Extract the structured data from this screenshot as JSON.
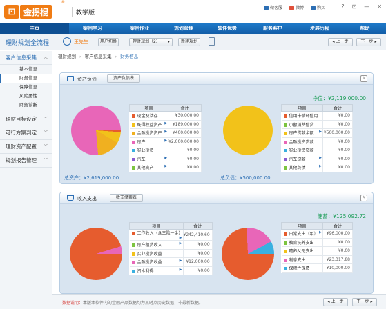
{
  "app": {
    "logo_text": "金拐棍",
    "logo_mark": "⊡",
    "edition": "教学版",
    "top_links": [
      {
        "label": "微客服",
        "icon": "chat-icon",
        "color": "#2d6fb4"
      },
      {
        "label": "微博",
        "icon": "weibo-icon",
        "color": "#e0503a"
      },
      {
        "label": "购买",
        "icon": "cart-icon",
        "color": "#2d6fb4"
      }
    ],
    "window_controls": [
      "?",
      "⊡",
      "—",
      "✕"
    ]
  },
  "nav": {
    "items": [
      "主页",
      "案例学习",
      "案例作业",
      "规划管理",
      "软件优势",
      "服务客户",
      "发展历程",
      "帮助"
    ],
    "active_index": 0
  },
  "subbar": {
    "title": "理财规划全流程",
    "user_name": "王先生",
    "switch_user": "用户切换",
    "plan_select": "理财规划（2）",
    "new_plan": "新建规划",
    "prev": "◂ 上一步",
    "next": "下一步 ▸"
  },
  "sidebar": {
    "groups": [
      {
        "label": "客户信息采集",
        "expanded": true,
        "children": [
          "基本信息",
          "财务信息",
          "保障信息",
          "风险属性",
          "财务诊断"
        ],
        "active_child": 1
      },
      {
        "label": "理财目标设定",
        "expanded": false,
        "children": []
      },
      {
        "label": "可行方案判定",
        "expanded": false,
        "children": []
      },
      {
        "label": "理财资产配置",
        "expanded": false,
        "children": []
      },
      {
        "label": "规划报告管理",
        "expanded": false,
        "children": []
      }
    ]
  },
  "breadcrumb": [
    "理财规划",
    "客户信息采集",
    "财务信息"
  ],
  "balance_panel": {
    "title": "资产负债",
    "button": "资产负债表",
    "net_label": "净值：¥2,119,000.00",
    "total_assets": "总资产：¥2,619,000.00",
    "total_liabilities": "总负债：¥500,000.00",
    "table_headers": [
      "项目",
      "合计"
    ],
    "assets": [
      {
        "label": "现金及活存",
        "value": "¥30,000.00",
        "color": "#e65c2e",
        "arrow": false
      },
      {
        "label": "既得权益资产",
        "value": "¥189,000.00",
        "color": "#f2c21a",
        "arrow": true
      },
      {
        "label": "金融投资资产",
        "value": "¥400,000.00",
        "color": "#f0b020",
        "arrow": true
      },
      {
        "label": "房产",
        "value": "¥2,000,000.00",
        "color": "#e866b8",
        "arrow": true
      },
      {
        "label": "实业投资",
        "value": "¥0.00",
        "color": "#3ab0e0",
        "arrow": false
      },
      {
        "label": "汽车",
        "value": "¥0.00",
        "color": "#8a5cd0",
        "arrow": true
      },
      {
        "label": "其他资产",
        "value": "¥0.00",
        "color": "#7cc440",
        "arrow": true
      }
    ],
    "liabilities": [
      {
        "label": "信用卡循环信用",
        "value": "¥0.00",
        "color": "#e65c2e"
      },
      {
        "label": "小额消费信贷",
        "value": "¥0.00",
        "color": "#7cc440"
      },
      {
        "label": "房产贷款余额",
        "value": "¥500,000.00",
        "color": "#f2c21a",
        "arrow": true
      },
      {
        "label": "金融投资贷款",
        "value": "¥0.00",
        "color": "#e866b8"
      },
      {
        "label": "实业投资贷款",
        "value": "¥0.00",
        "color": "#3ab0e0"
      },
      {
        "label": "汽车贷款",
        "value": "¥0.00",
        "color": "#8a5cd0",
        "arrow": true
      },
      {
        "label": "其他负债",
        "value": "¥0.00",
        "color": "#7cc440",
        "arrow": true
      }
    ]
  },
  "income_panel": {
    "title": "收入支出",
    "button": "收支储蓄表",
    "savings_label": "储蓄：¥125,092.72",
    "table_headers": [
      "项目",
      "合计"
    ],
    "income": [
      {
        "label": "工作收入（含三险一金）",
        "value": "¥242,410.60",
        "color": "#e65c2e",
        "arrow": true
      },
      {
        "label": "房产租赁收入",
        "value": "¥0.00",
        "color": "#7cc440",
        "arrow": true
      },
      {
        "label": "实业投资收益",
        "value": "¥0.00",
        "color": "#f2c21a"
      },
      {
        "label": "金融投资收益",
        "value": "¥12,000.00",
        "color": "#e866b8",
        "arrow": true
      },
      {
        "label": "资本利得",
        "value": "¥0.00",
        "color": "#3ab0e0",
        "arrow": true
      }
    ],
    "expense": [
      {
        "label": "日常支出（年）",
        "value": "¥96,000.00",
        "color": "#e65c2e",
        "arrow": true
      },
      {
        "label": "教育抚养支出",
        "value": "¥0.00",
        "color": "#7cc440"
      },
      {
        "label": "赡养父母支出",
        "value": "¥0.00",
        "color": "#f2c21a"
      },
      {
        "label": "利息支出",
        "value": "¥23,317.88",
        "color": "#e866b8"
      },
      {
        "label": "保障性保费",
        "value": "¥10,000.00",
        "color": "#3ab0e0"
      }
    ]
  },
  "footer": {
    "note_label": "数据说明：",
    "note_text": "本版本软件内的金融产品数据均为某时点历史数据，非最新数据。",
    "prev": "◂ 上一步",
    "next": "下一步 ▸"
  }
}
